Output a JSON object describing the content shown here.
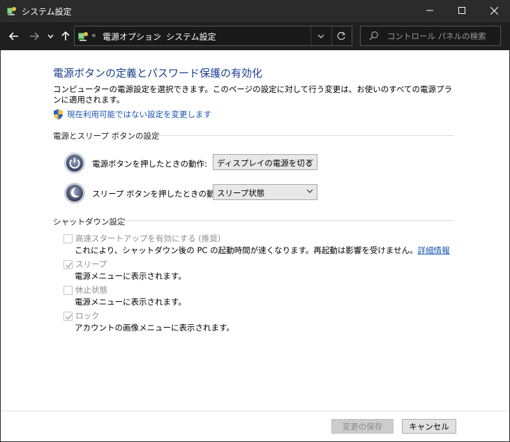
{
  "window": {
    "title": "システム設定",
    "minimize_label": "",
    "maximize_label": "",
    "close_label": ""
  },
  "address_bar": {
    "overflow": "«",
    "breadcrumbs": [
      "電源オプション",
      "システム設定"
    ],
    "separator": "›"
  },
  "search": {
    "placeholder": "コントロール パネルの検索"
  },
  "main": {
    "heading": "電源ボタンの定義とパスワード保護の有効化",
    "description": "コンピューターの電源設定を選択できます。このページの設定に対して行う変更は、お使いのすべての電源プランに適用されます。",
    "admin_link": "現在利用可能ではない設定を変更します",
    "power_group": {
      "label": "電源とスリープ ボタンの設定",
      "rows": [
        {
          "label": "電源ボタンを押したときの動作:",
          "selected": "ディスプレイの電源を切る",
          "icon": "power-button-icon"
        },
        {
          "label": "スリープ ボタンを押したときの動作:",
          "selected": "スリープ状態",
          "icon": "sleep-button-icon"
        }
      ]
    },
    "shutdown_group": {
      "label": "シャットダウン設定",
      "options": [
        {
          "title": "高速スタートアップを有効にする (推奨)",
          "description": "これにより、シャットダウン後の PC の起動時間が速くなります。再起動は影響を受けません。",
          "more_link": "詳細情報",
          "checked": false
        },
        {
          "title": "スリープ",
          "description": "電源メニューに表示されます。",
          "checked": true
        },
        {
          "title": "休止状態",
          "description": "電源メニューに表示されます。",
          "checked": false
        },
        {
          "title": "ロック",
          "description": "アカウントの画像メニューに表示されます。",
          "checked": true
        }
      ]
    }
  },
  "footer": {
    "save_label": "変更の保存",
    "cancel_label": "キャンセル"
  },
  "colors": {
    "title_bar": "#2b2b2b",
    "nav_bar": "#1f1f1f",
    "heading": "#1a3e8c",
    "link": "#1a56b0",
    "disabled_text": "#8c8c8c"
  }
}
